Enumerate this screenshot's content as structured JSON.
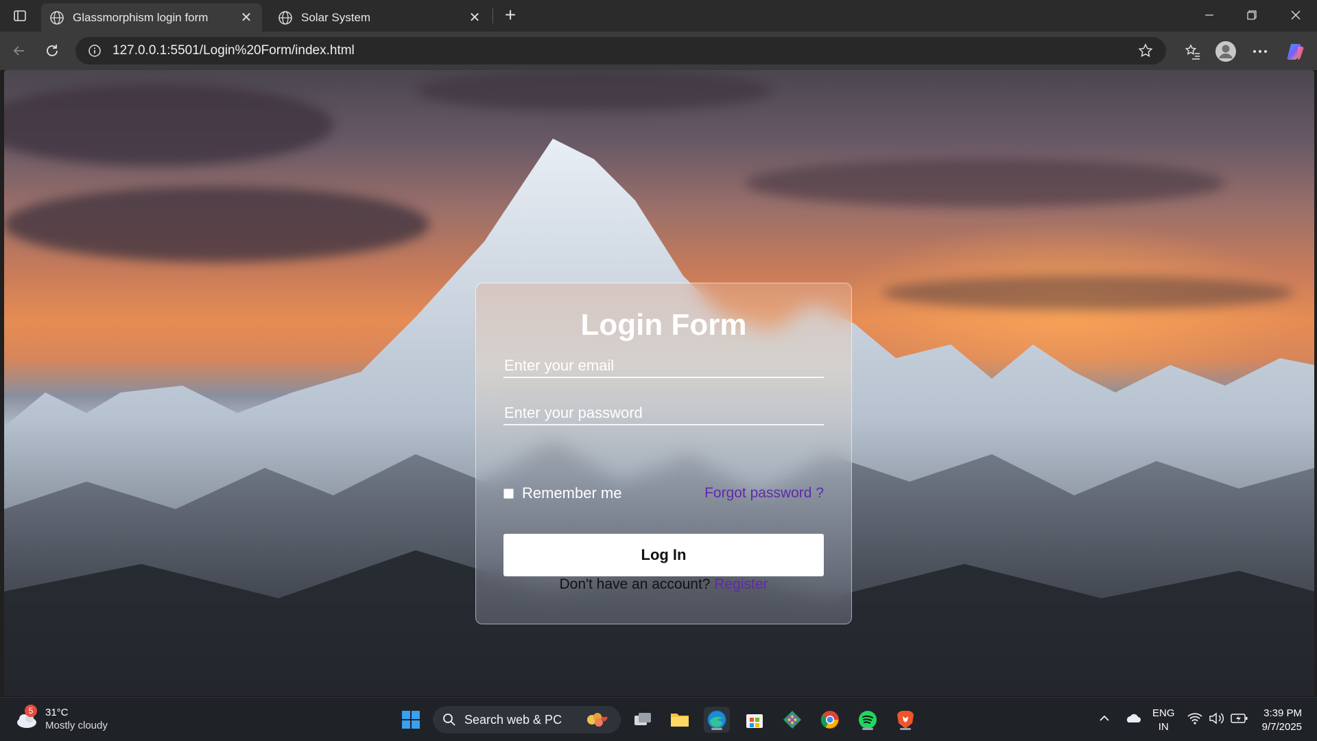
{
  "browser": {
    "tabs": [
      {
        "title": "Glassmorphism login form",
        "active": true
      },
      {
        "title": "Solar System",
        "active": false
      }
    ],
    "close_glyph": "✕",
    "new_tab_glyph": "+",
    "url": "127.0.0.1:5501/Login%20Form/index.html"
  },
  "form": {
    "title": "Login Form",
    "email_placeholder": "Enter your email",
    "password_placeholder": "Enter your password",
    "remember_label": "Remember me",
    "forgot_link": "Forgot password ?",
    "login_button": "Log In",
    "register_prompt": "Don't have an account?",
    "register_link": "Register"
  },
  "taskbar": {
    "weather": {
      "badge": "5",
      "temp": "31°C",
      "desc": "Mostly cloudy"
    },
    "search_label": "Search web & PC",
    "lang": {
      "line1": "ENG",
      "line2": "IN"
    },
    "clock": {
      "time": "3:39 PM",
      "date": "9/7/2025"
    }
  },
  "colors": {
    "link": "#5e2ba8",
    "tabbar": "#2b2b2b",
    "taskbar": "#1f2328"
  }
}
